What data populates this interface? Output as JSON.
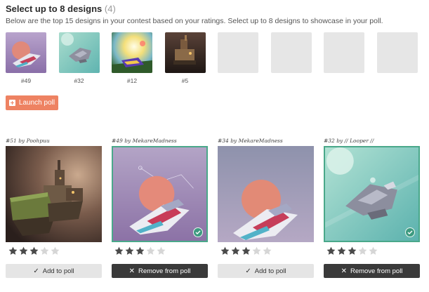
{
  "header": {
    "title": "Select up to 8 designs",
    "count": "(4)",
    "subtitle": "Below are the top 15 designs in your contest based on your ratings. Select up to 8 designs to showcase in your poll."
  },
  "slots": [
    {
      "number": "#49",
      "filled": true
    },
    {
      "number": "#32",
      "filled": true
    },
    {
      "number": "#12",
      "filled": true
    },
    {
      "number": "#5",
      "filled": true
    },
    {
      "number": "",
      "filled": false
    },
    {
      "number": "",
      "filled": false
    },
    {
      "number": "",
      "filled": false
    },
    {
      "number": "",
      "filled": false
    }
  ],
  "launch_button": {
    "label": "Launch poll",
    "icon": "plus-square-icon",
    "color": "#ee8262"
  },
  "designs": [
    {
      "caption": "#51 by Poohpuu",
      "rating": 3,
      "max_rating": 5,
      "selected": false,
      "button_label": "Add to poll",
      "button_icon": "check-icon"
    },
    {
      "caption": "#49 by MekareMadness",
      "rating": 3,
      "max_rating": 5,
      "selected": true,
      "button_label": "Remove from poll",
      "button_icon": "close-icon"
    },
    {
      "caption": "#34 by MekareMadness",
      "rating": 3,
      "max_rating": 5,
      "selected": false,
      "button_label": "Add to poll",
      "button_icon": "check-icon"
    },
    {
      "caption": "#32 by // Looper //",
      "rating": 3,
      "max_rating": 5,
      "selected": true,
      "button_label": "Remove from poll",
      "button_icon": "close-icon"
    }
  ],
  "colors": {
    "selected_border": "#4aa88a",
    "star_filled": "#4a4a4a",
    "star_empty": "#d6d6d6",
    "remove_button": "#3a3a3a",
    "add_button": "#e5e5e5"
  }
}
